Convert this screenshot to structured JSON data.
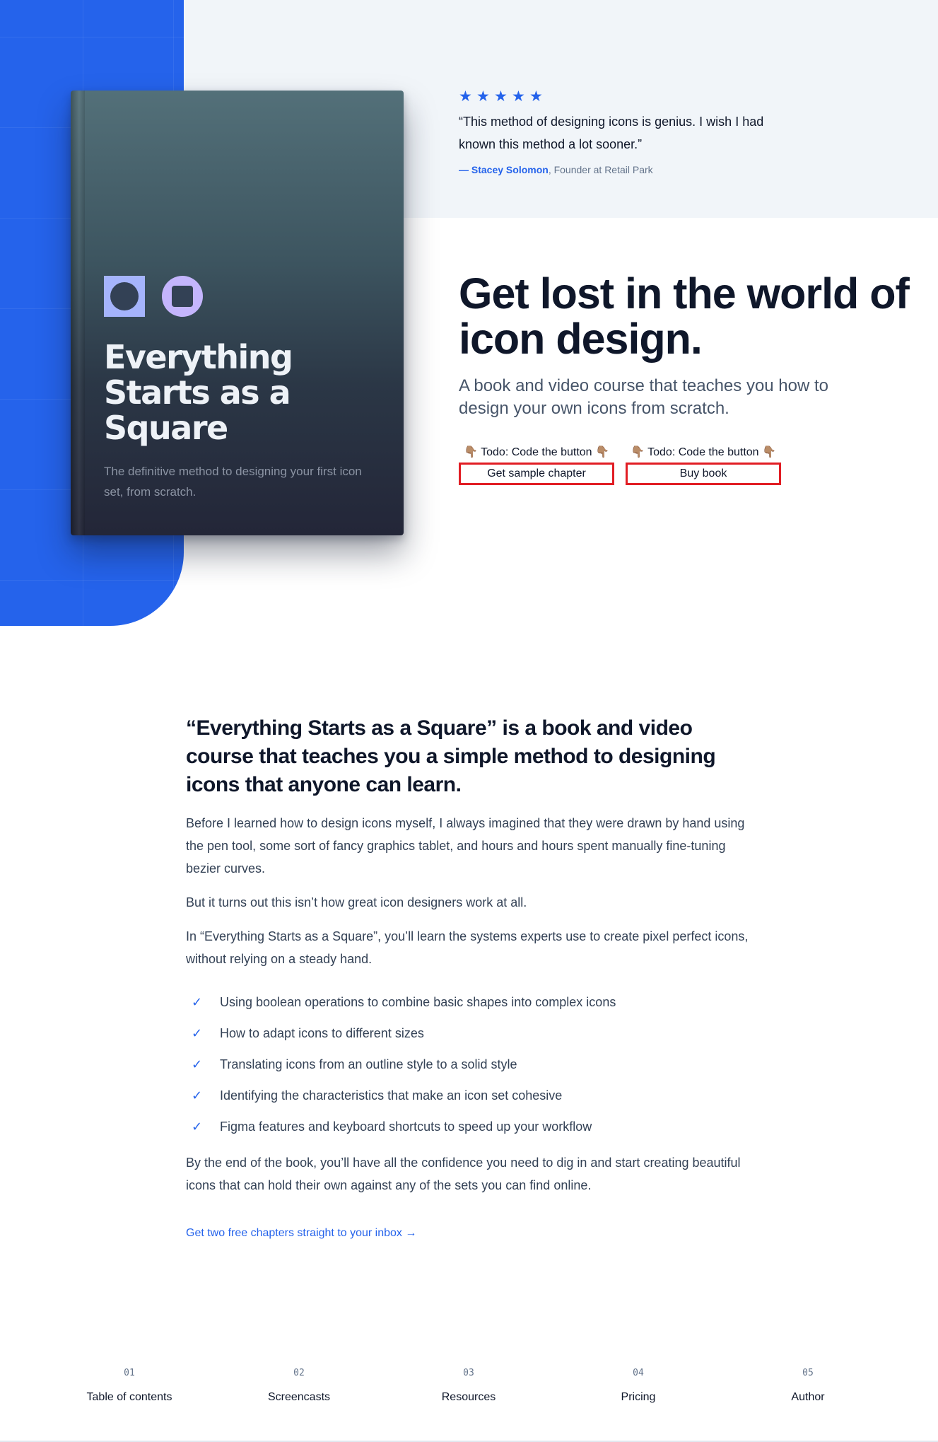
{
  "book": {
    "title": "Everything Starts as a Square",
    "subtitle": "The definitive method to designing your first icon set, from scratch."
  },
  "testimonial": {
    "rating": 5,
    "stars": [
      "★",
      "★",
      "★",
      "★",
      "★"
    ],
    "quote": "“This method of designing icons is genius. I wish I had known this method a lot sooner.”",
    "author_name": "— Stacey Solomon",
    "author_role": ", Founder at Retail Park"
  },
  "hero": {
    "headline": "Get lost in the world of icon design.",
    "lead": "A book and video course that teaches you how to design your own icons from scratch.",
    "todo_label": "👇🏽 Todo: Code the button 👇🏽",
    "sample_button": "Get sample chapter",
    "buy_button": "Buy book"
  },
  "intro": {
    "heading": "“Everything Starts as a Square” is a book and video course that teaches you a simple method to designing icons that anyone can learn.",
    "paragraphs": [
      "Before I learned how to design icons myself, I always imagined that they were drawn by hand using the pen tool, some sort of fancy graphics tablet, and hours and hours spent manually fine-tuning bezier curves.",
      "But it turns out this isn’t how great icon designers work at all.",
      "In “Everything Starts as a Square”, you’ll learn the systems experts use to create pixel perfect icons, without relying on a steady hand."
    ],
    "check_glyph": "✓",
    "checklist": [
      "Using boolean operations to combine basic shapes into complex icons",
      "How to adapt icons to different sizes",
      "Translating icons from an outline style to a solid style",
      "Identifying the characteristics that make an icon set cohesive",
      "Figma features and keyboard shortcuts to speed up your workflow"
    ],
    "closing": "By the end of the book, you’ll have all the confidence you need to dig in and start creating beautiful icons that can hold their own against any of the sets you can find online.",
    "cta": "Get two free chapters straight to your inbox →"
  },
  "nav": {
    "items": [
      {
        "number": "01",
        "label": "Table of contents"
      },
      {
        "number": "02",
        "label": "Screencasts"
      },
      {
        "number": "03",
        "label": "Resources"
      },
      {
        "number": "04",
        "label": "Pricing"
      },
      {
        "number": "05",
        "label": "Author"
      }
    ]
  },
  "colors": {
    "accent": "#2563eb",
    "page_tint": "#f1f5f9",
    "todo_border": "#e11d24",
    "book_top": "#537079",
    "book_bottom": "#232638"
  }
}
